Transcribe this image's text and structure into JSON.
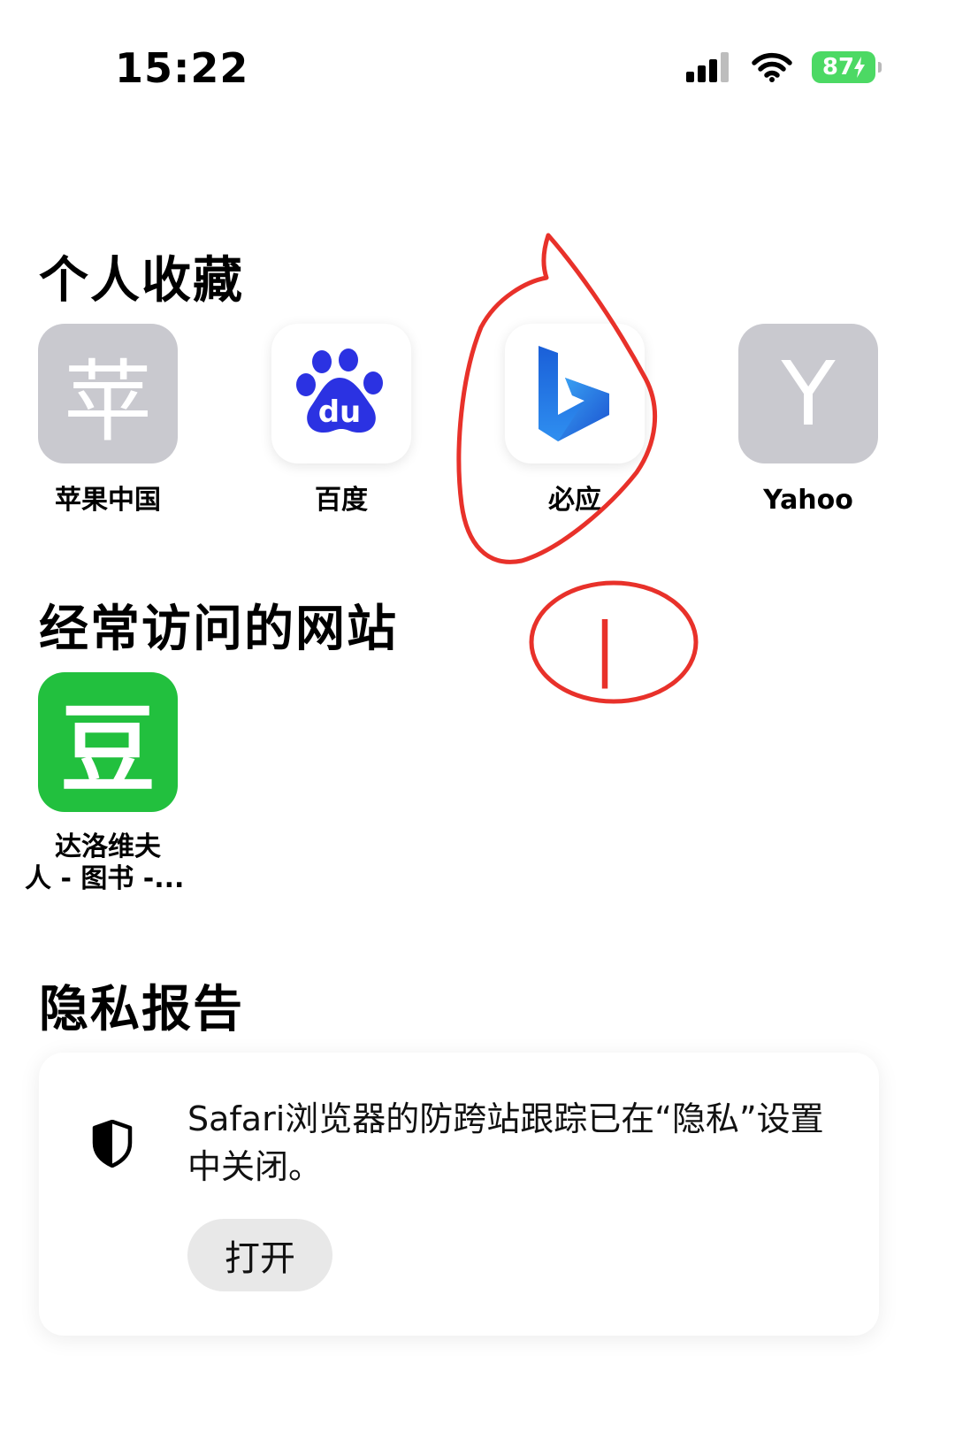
{
  "status_bar": {
    "time": "15:22",
    "battery_level": "87"
  },
  "favorites": {
    "title": "个人收藏",
    "items": [
      {
        "label": "苹果中国",
        "icon_glyph": "苹",
        "icon": "apple-china-letter-icon"
      },
      {
        "label": "百度",
        "icon": "baidu-paw-icon",
        "icon_text": "du"
      },
      {
        "label": "必应",
        "icon": "bing-logo-icon"
      },
      {
        "label": "Yahoo",
        "icon_glyph": "Y",
        "icon": "yahoo-letter-icon"
      }
    ]
  },
  "frequent": {
    "title": "经常访问的网站",
    "items": [
      {
        "label_line1": "达洛维夫",
        "label_line2": "人 - 图书 -...",
        "icon_glyph": "豆",
        "icon": "douban-icon"
      }
    ]
  },
  "privacy": {
    "title": "隐私报告",
    "message": "Safari浏览器的防跨站跟踪已在“隐私”设置中关闭。",
    "button_label": "打开",
    "icon": "shield-icon"
  },
  "annotation": {
    "circled_mark": "|"
  },
  "colors": {
    "accent_green": "#22c03e",
    "battery_green": "#4cd964",
    "annotation_red": "#e8312a",
    "tile_gray": "#c9c9cf",
    "baidu_blue": "#2b32e2",
    "bing_blue": "#1b6fe6"
  }
}
